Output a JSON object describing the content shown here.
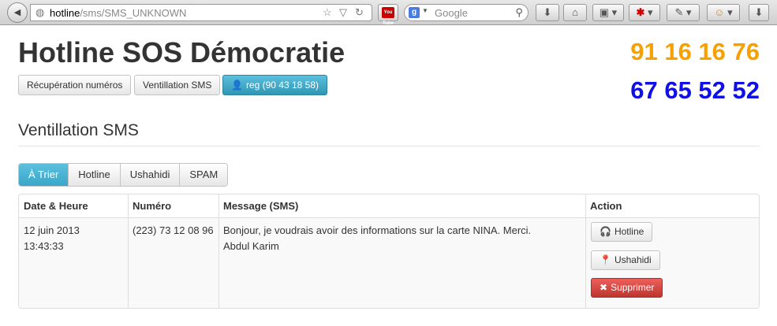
{
  "browser": {
    "url_host": "hotline",
    "url_path": "/sms/SMS_UNKNOWN",
    "search_engine": "Google",
    "youtube_label": "You Tube"
  },
  "header": {
    "title": "Hotline SOS Démocratie",
    "phone_primary": "91 16 16 76",
    "phone_secondary": "67 65 52 52",
    "phone_primary_color": "#f7a100",
    "phone_secondary_color": "#1010e6"
  },
  "nav": {
    "recuperation_label": "Récupération numéros",
    "ventillation_label": "Ventillation SMS",
    "user_label": "reg (90 43 18 58)"
  },
  "section": {
    "title": "Ventillation SMS"
  },
  "tabs": [
    {
      "label": "À Trier",
      "active": true
    },
    {
      "label": "Hotline",
      "active": false
    },
    {
      "label": "Ushahidi",
      "active": false
    },
    {
      "label": "SPAM",
      "active": false
    }
  ],
  "table": {
    "headers": [
      "Date & Heure",
      "Numéro",
      "Message (SMS)",
      "Action"
    ],
    "rows": [
      {
        "date": "12 juin 2013",
        "time": "13:43:33",
        "number": "(223) 73 12 08 96",
        "message_line1": "Bonjour, je voudrais avoir des informations sur la carte NINA. Merci.",
        "message_line2": "Abdul Karim",
        "actions": {
          "hotline_label": "Hotline",
          "ushahidi_label": "Ushahidi",
          "delete_label": "Supprimer"
        }
      }
    ]
  },
  "colors": {
    "accent_info": "#5bc0de",
    "danger": "#da4f49"
  }
}
